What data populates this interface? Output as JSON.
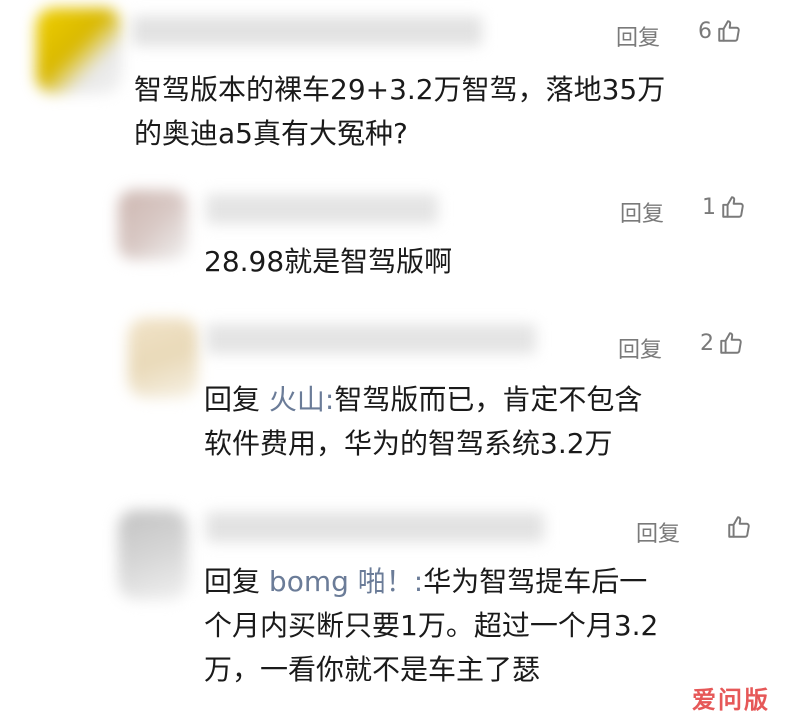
{
  "comments": [
    {
      "reply_label": "回复",
      "like_count": "6",
      "text_lines": [
        "智驾版本的裸车29+3.2万智驾，落地35万",
        "的奥迪a5真有大冤种?"
      ]
    },
    {
      "reply_label": "回复",
      "like_count": "1",
      "text_lines": [
        "28.98就是智驾版啊"
      ]
    },
    {
      "reply_label": "回复",
      "like_count": "2",
      "reply_prefix": "回复",
      "reply_to": "火山:",
      "text_lines": [
        "智驾版而已，肯定不包含",
        "软件费用，华为的智驾系统3.2万"
      ]
    },
    {
      "reply_label": "回复",
      "like_count": "",
      "reply_prefix": "回复",
      "reply_to": "bomg 啪！:",
      "text_lines": [
        "华为智驾提车后一",
        "个月内买断只要1万。超过一个月3.2",
        "万，一看你就不是车主了瑟"
      ]
    }
  ],
  "watermark": "爱问版"
}
